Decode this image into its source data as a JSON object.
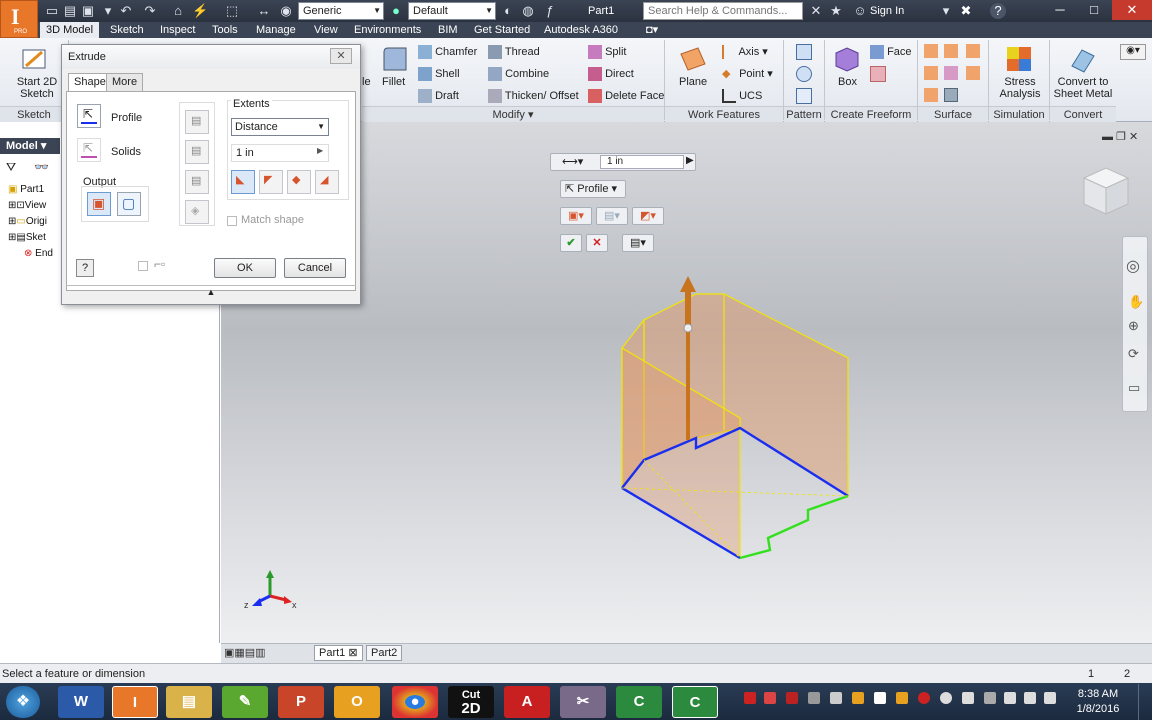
{
  "app": {
    "title": "Part1",
    "material": "Generic",
    "appearance": "Default",
    "search_placeholder": "Search Help & Commands...",
    "sign_in": "Sign In",
    "logo_sub": "PRO"
  },
  "tabs": [
    "3D Model",
    "Sketch",
    "Inspect",
    "Tools",
    "Manage",
    "View",
    "Environments",
    "BIM",
    "Get Started",
    "Autodesk A360"
  ],
  "ribbon": {
    "start_sketch": "Start 2D Sketch",
    "panels": {
      "sketch": "Sketch",
      "modify": "Modify",
      "work_features": "Work Features",
      "pattern": "Pattern",
      "create_freeform": "Create Freeform",
      "surface": "Surface",
      "simulation": "Simulation",
      "convert": "Convert"
    },
    "partial_left": "le",
    "fillet": "Fillet",
    "modify_items": [
      "Chamfer",
      "Thread",
      "Split",
      "Shell",
      "Combine",
      "Direct",
      "Draft",
      "Thicken/ Offset",
      "Delete Face"
    ],
    "plane": "Plane",
    "axis": "Axis",
    "point": "Point",
    "ucs": "UCS",
    "box": "Box",
    "face": "Face",
    "stress": "Stress Analysis",
    "convert_sheet": "Convert to Sheet Metal"
  },
  "browser": {
    "header": "Model",
    "items": [
      "Part1",
      "View",
      "Origi",
      "Sket",
      "End"
    ]
  },
  "dialog": {
    "title": "Extrude",
    "tabs": [
      "Shape",
      "More"
    ],
    "profile": "Profile",
    "solids": "Solids",
    "output": "Output",
    "extents": "Extents",
    "extents_value": "Distance",
    "distance_value": "1 in",
    "match_shape": "Match shape",
    "ok": "OK",
    "cancel": "Cancel"
  },
  "minitoolbar": {
    "distance": "1 in",
    "profile": "Profile"
  },
  "status": {
    "message": "Select a feature or dimension",
    "count1": "1",
    "count2": "2"
  },
  "doc_tabs": [
    "Part1",
    "Part2"
  ],
  "taskbar": {
    "cut2d_top": "Cut",
    "cut2d_bottom": "2D",
    "time": "8:38 AM",
    "date": "1/8/2016"
  },
  "axis": {
    "z": "z",
    "x": "x"
  },
  "colors": {
    "accent": "#e8772a",
    "titlebar": "#2b323f",
    "edge_blue": "#1a2ef0",
    "edge_yellow": "#f2e600",
    "edge_green": "#33e01e"
  }
}
